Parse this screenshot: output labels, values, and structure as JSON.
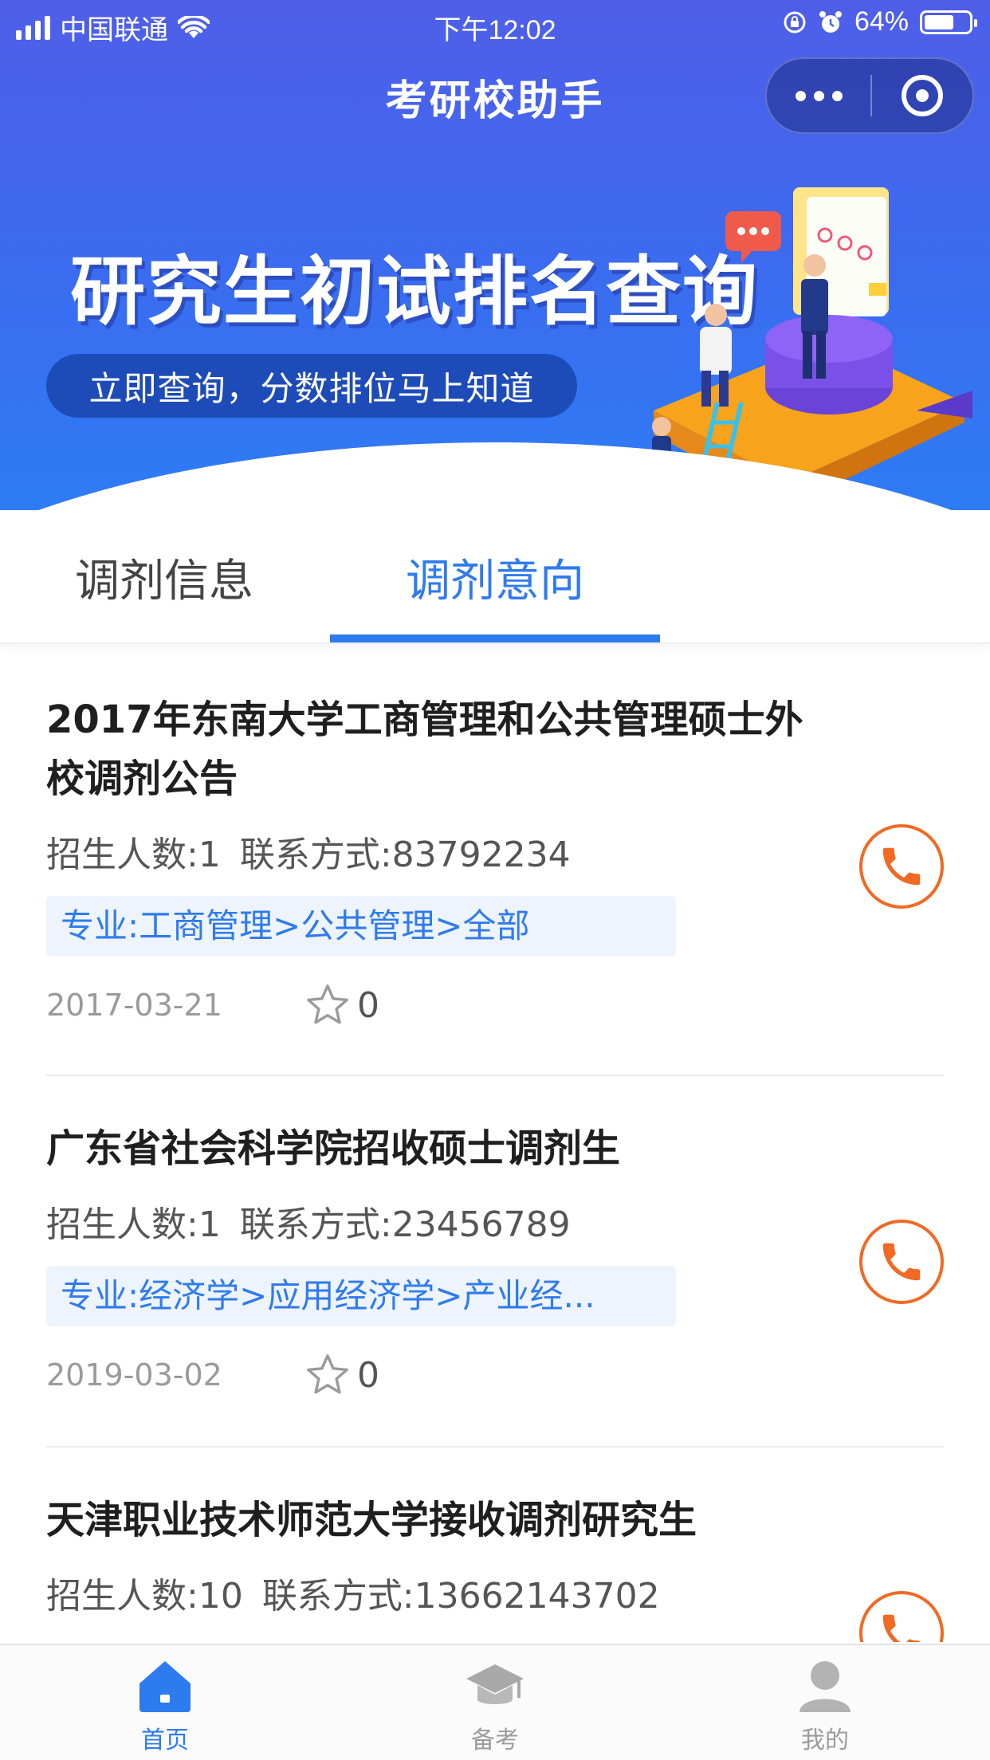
{
  "status_bar": {
    "carrier": "中国联通",
    "time": "下午12:02",
    "battery": "64%",
    "signal_icon": "signal-bars-icon",
    "wifi_icon": "wifi-icon"
  },
  "header": {
    "title": "考研校助手",
    "more_icon": "more-dots-icon",
    "close_icon": "target-circle-icon"
  },
  "banner": {
    "headline": "研究生初试排名查询",
    "subline": "立即查询，分数排位马上知道"
  },
  "tabs": [
    {
      "label": "调剂信息",
      "active": false
    },
    {
      "label": "调剂意向",
      "active": true
    }
  ],
  "listings": [
    {
      "title": "2017年东南大学工商管理和公共管理硕士外校调剂公告",
      "enrollment": "招生人数:1",
      "contact": "联系方式:83792234",
      "major": "专业:工商管理>公共管理>全部",
      "date": "2017-03-21",
      "favorites": "0"
    },
    {
      "title": "广东省社会科学院招收硕士调剂生",
      "enrollment": "招生人数:1",
      "contact": "联系方式:23456789",
      "major": "专业:经济学>应用经济学>产业经...",
      "date": "2019-03-02",
      "favorites": "0"
    },
    {
      "title": "天津职业技术师范大学接收调剂研究生",
      "enrollment": "招生人数:10",
      "contact": "联系方式:13662143702",
      "major": "",
      "date": "",
      "favorites": ""
    }
  ],
  "bottom_nav": [
    {
      "label": "首页",
      "icon": "home-icon",
      "active": true
    },
    {
      "label": "备考",
      "icon": "graduation-cap-icon",
      "active": false
    },
    {
      "label": "我的",
      "icon": "user-icon",
      "active": false
    }
  ],
  "colors": {
    "accent": "#2e7bf0",
    "call": "#f06a23",
    "banner_top": "#4f5ee9",
    "banner_bottom": "#2e7cf5"
  }
}
